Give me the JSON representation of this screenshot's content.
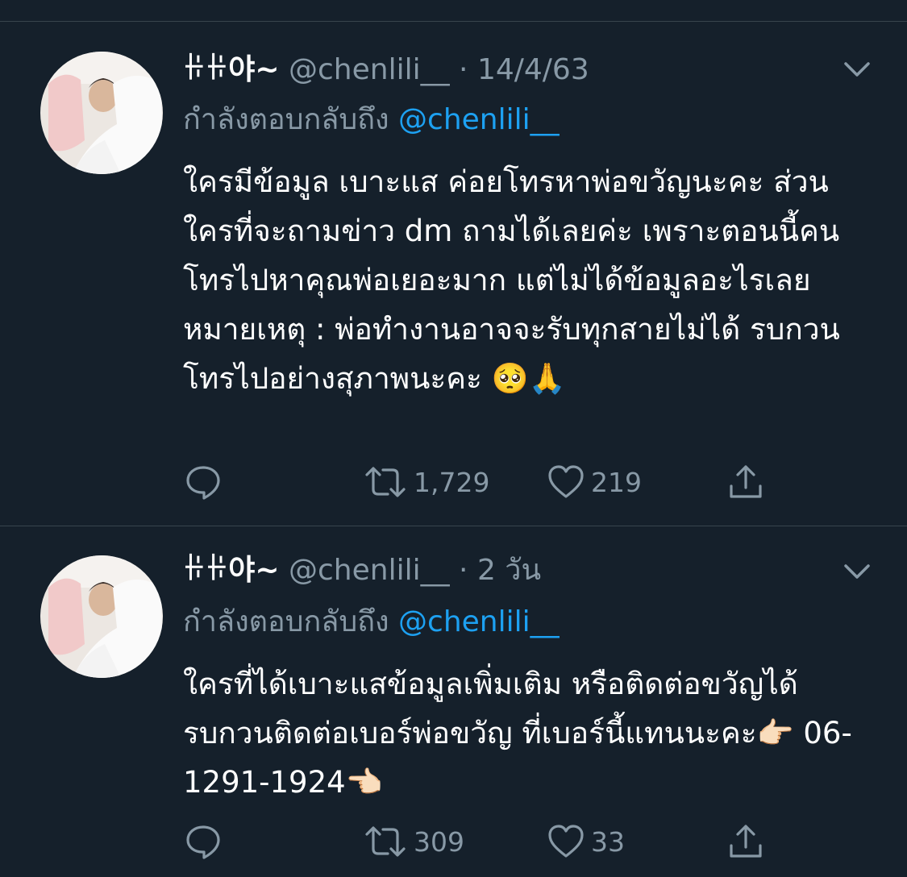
{
  "tweets": [
    {
      "display_name": "ꃌꃌ야~",
      "handle": "@chenlili__",
      "separator": "·",
      "time": "14/4/63",
      "reply_label": "กำลังตอบกลับถึง",
      "reply_mention": "@chenlili__",
      "text": "ใครมีข้อมูล เบาะแส ค่อยโทรหาพ่อขวัญนะคะ ส่วนใครที่จะถามข่าว dm ถามได้เลยค่ะ เพราะตอนนี้คนโทรไปหาคุณพ่อเยอะมาก แต่ไม่ได้ข้อมูลอะไรเลย หมายเหตุ : พ่อทำงานอาจจะรับทุกสายไม่ได้ รบกวนโทรไปอย่างสุภาพนะคะ 🥺🙏",
      "retweets": "1,729",
      "likes": "219",
      "icons": {
        "reply": "reply-bubble-icon",
        "retweet": "retweet-arrows-icon",
        "like": "heart-icon",
        "share": "share-upload-icon",
        "more": "chevron-down-icon"
      }
    },
    {
      "display_name": "ꃌꃌ야~",
      "handle": "@chenlili__",
      "separator": "·",
      "time": "2 วัน",
      "reply_label": "กำลังตอบกลับถึง",
      "reply_mention": "@chenlili__",
      "text": "ใครที่ได้เบาะแสข้อมูลเพิ่มเติม หรือติดต่อขวัญได้ รบกวนติดต่อเบอร์พ่อขวัญ ที่เบอร์นี้แทนนะคะ👉🏻 06-1291-1924👈🏻",
      "retweets": "309",
      "likes": "33",
      "icons": {
        "reply": "reply-bubble-icon",
        "retweet": "retweet-arrows-icon",
        "like": "heart-icon",
        "share": "share-upload-icon",
        "more": "chevron-down-icon"
      }
    }
  ],
  "colors": {
    "background": "#15202b",
    "primary_text": "#ffffff",
    "secondary_text": "#8899a6",
    "link": "#1da1f2",
    "divider": "#38444d"
  }
}
